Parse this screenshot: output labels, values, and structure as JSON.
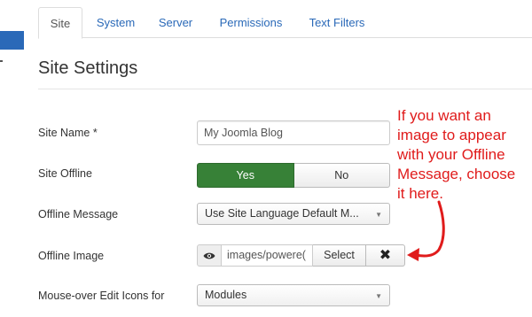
{
  "tabs": [
    {
      "label": "Site",
      "active": true
    },
    {
      "label": "System",
      "active": false
    },
    {
      "label": "Server",
      "active": false
    },
    {
      "label": "Permissions",
      "active": false
    },
    {
      "label": "Text Filters",
      "active": false
    }
  ],
  "page_title": "Site Settings",
  "fields": {
    "site_name": {
      "label": "Site Name *",
      "value": "My Joomla Blog"
    },
    "site_offline": {
      "label": "Site Offline",
      "yes_label": "Yes",
      "no_label": "No",
      "selected": "Yes"
    },
    "offline_message": {
      "label": "Offline Message",
      "value": "Use Site Language Default M..."
    },
    "offline_image": {
      "label": "Offline Image",
      "value": "images/powere(",
      "select_label": "Select",
      "clear_symbol": "✖",
      "preview_icon": "eye-icon"
    },
    "mouseover_edit": {
      "label": "Mouse-over Edit Icons for",
      "value": "Modules"
    }
  },
  "annotation": {
    "text_lines": [
      "If you want an",
      "image to appear",
      "with your Offline",
      "Message, choose",
      "it here."
    ],
    "color": "#e01b1b"
  },
  "colors": {
    "accent": "#2a69b8",
    "toggle_on": "#378137"
  }
}
